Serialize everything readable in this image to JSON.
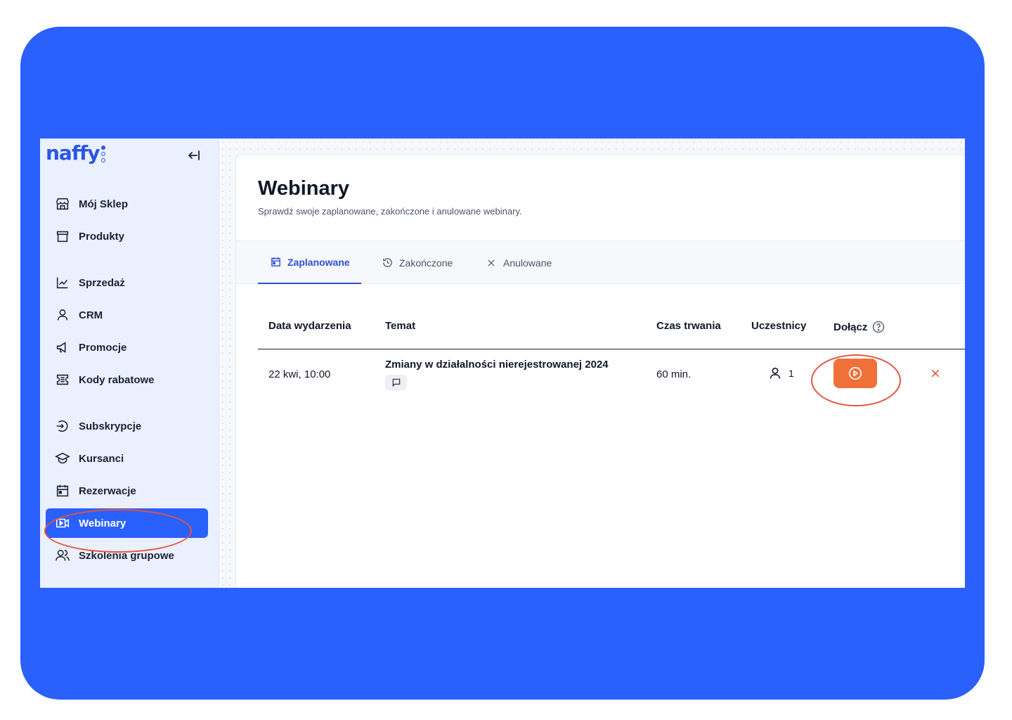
{
  "brand": {
    "logo_text": "naffy"
  },
  "sidebar": {
    "items": [
      {
        "label": "Mój Sklep",
        "icon": "store-icon"
      },
      {
        "label": "Produkty",
        "icon": "box-icon"
      },
      {
        "label": "Sprzedaż",
        "icon": "chart-line-icon"
      },
      {
        "label": "CRM",
        "icon": "user-icon"
      },
      {
        "label": "Promocje",
        "icon": "megaphone-icon"
      },
      {
        "label": "Kody rabatowe",
        "icon": "ticket-icon"
      },
      {
        "label": "Subskrypcje",
        "icon": "enter-circle-icon"
      },
      {
        "label": "Kursanci",
        "icon": "graduation-cap-icon"
      },
      {
        "label": "Rezerwacje",
        "icon": "calendar-icon"
      },
      {
        "label": "Webinary",
        "icon": "video-icon",
        "active": true
      },
      {
        "label": "Szkolenia grupowe",
        "icon": "users-icon"
      }
    ]
  },
  "page": {
    "title": "Webinary",
    "subtitle": "Sprawdź swoje zaplanowane, zakończone i anulowane webinary."
  },
  "tabs": [
    {
      "label": "Zaplanowane",
      "icon": "calendar-icon",
      "active": true
    },
    {
      "label": "Zakończone",
      "icon": "history-icon"
    },
    {
      "label": "Anulowane",
      "icon": "close-icon"
    }
  ],
  "table": {
    "columns": [
      "Data wydarzenia",
      "Temat",
      "Czas trwania",
      "Uczestnicy",
      "Dołącz"
    ],
    "rows": [
      {
        "date": "22 kwi, 10:00",
        "topic": "Zmiany w działalności nierejestrowanej 2024",
        "duration": "60 min.",
        "participants": "1"
      }
    ]
  },
  "colors": {
    "accent": "#2a60fb",
    "join": "#f0703a",
    "danger": "#e5533f"
  }
}
